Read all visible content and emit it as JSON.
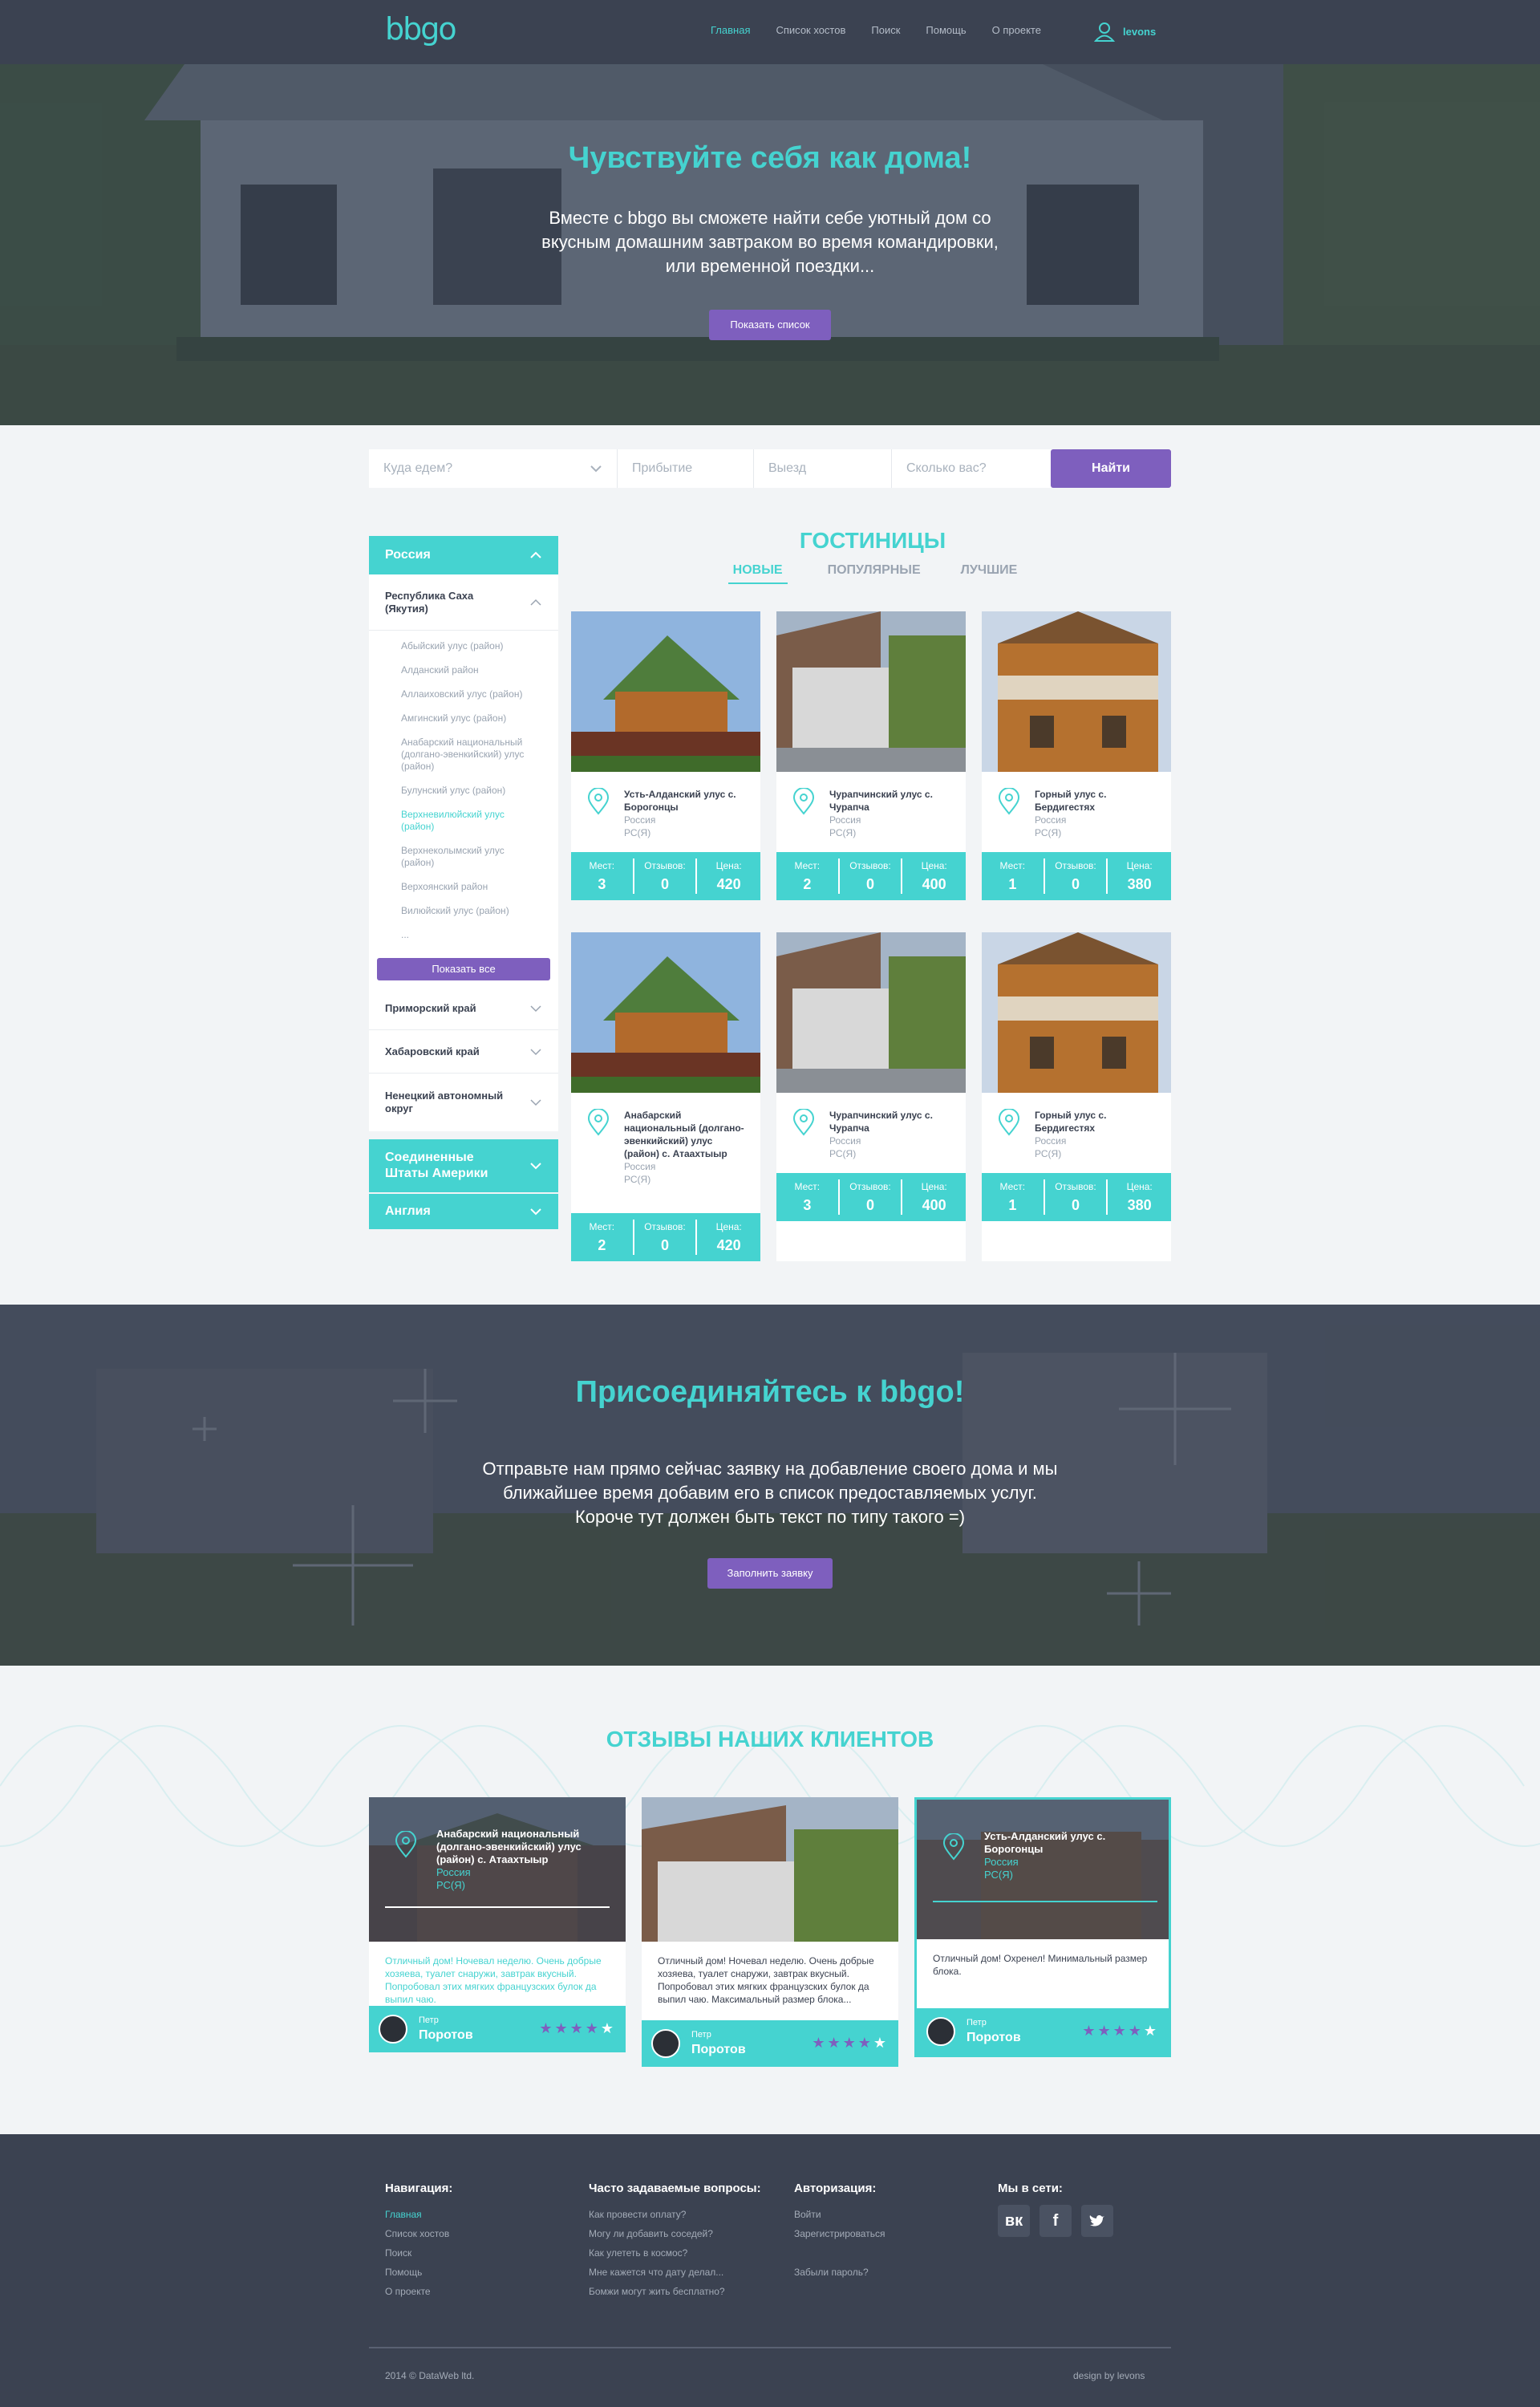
{
  "header": {
    "logo": "bbgo",
    "nav": [
      "Главная",
      "Список хостов",
      "Поиск",
      "Помощь",
      "О проекте"
    ],
    "user": "levons"
  },
  "hero": {
    "title": "Чувствуйте себя как дома!",
    "text": "Вместе с bbgo вы сможете найти себе уютный дом со вкусным домашним завтраком во время командировки, или временной поездки...",
    "button": "Показать список"
  },
  "search": {
    "where": "Куда едем?",
    "arrival": "Прибытие",
    "departure": "Выезд",
    "guests": "Сколько вас?",
    "button": "Найти"
  },
  "sidebar": {
    "country1": "Россия",
    "region_open": "Республика Саха (Якутия)",
    "districts": [
      "Абыйский улус (район)",
      "Алданский район",
      "Аллаиховский улус (район)",
      "Амгинский улус (район)",
      "Анабарский национальный (долгано-эвенкийский) улус (район)",
      "Булунский улус (район)",
      "Верхневилюйский улус (район)",
      "Верхнеколымский улус (район)",
      "Верхоянский район",
      "Вилюйский улус (район)",
      "..."
    ],
    "show_all": "Показать все",
    "regions": [
      "Приморский край",
      "Хабаровский край",
      "Ненецкий автономный округ"
    ],
    "country2": "Соединенные Штаты Америки",
    "country3": "Англия"
  },
  "catalog": {
    "title": "ГОСТИНИЦЫ",
    "tabs": [
      "НОВЫЕ",
      "ПОПУЛЯРНЫЕ",
      "ЛУЧШИЕ"
    ],
    "labels": {
      "places": "Мест:",
      "reviews": "Отзывов:",
      "price": "Цена:"
    },
    "cards": [
      {
        "name": "Усть-Алданский улус с. Борогонцы",
        "country": "Россия",
        "region": "РС(Я)",
        "places": "3",
        "reviews": "0",
        "price": "420"
      },
      {
        "name": "Чурапчинский улус с. Чурапча",
        "country": "Россия",
        "region": "РС(Я)",
        "places": "2",
        "reviews": "0",
        "price": "400"
      },
      {
        "name": "Горный улус с. Бердигестях",
        "country": "Россия",
        "region": "РС(Я)",
        "places": "1",
        "reviews": "0",
        "price": "380"
      },
      {
        "name": "Анабарский национальный (долгано-эвенкийский) улус (район) с. Атаахтыыр",
        "country": "Россия",
        "region": "РС(Я)",
        "places": "2",
        "reviews": "0",
        "price": "420"
      },
      {
        "name": "Чурапчинский улус с. Чурапча",
        "country": "Россия",
        "region": "РС(Я)",
        "places": "3",
        "reviews": "0",
        "price": "400"
      },
      {
        "name": "Горный улус с. Бердигестях",
        "country": "Россия",
        "region": "РС(Я)",
        "places": "1",
        "reviews": "0",
        "price": "380"
      }
    ]
  },
  "join": {
    "title": "Присоединяйтесь к bbgo!",
    "text": "Отправьте нам прямо сейчас заявку на добавление своего дома и мы ближайшее время добавим его в список предоставляемых услуг. Короче тут должен быть текст по типу такого =)",
    "button": "Заполнить заявку"
  },
  "reviews": {
    "title": "ОТЗЫВЫ НАШИХ КЛИЕНТОВ",
    "items": [
      {
        "place": "Анабарский национальный (долгано-эвенкийский) улус (район) с. Атаахтыыр",
        "country": "Россия",
        "region": "РС(Я)",
        "text": "Отличный дом! Ночевал неделю. Очень добрые хозяева, туалет снаружи, завтрак вкусный. Попробовал этих мягких французских булок да выпил чаю.",
        "first": "Петр",
        "last": "Поротов",
        "rating": 4
      },
      {
        "text": "Отличный дом! Ночевал неделю. Очень добрые хозяева, туалет снаружи, завтрак вкусный. Попробовал этих мягких французских булок да выпил чаю. Максимальный размер блока...",
        "first": "Петр",
        "last": "Поротов",
        "rating": 4
      },
      {
        "place": "Усть-Алданский улус с. Борогонцы",
        "country": "Россия",
        "region": "РС(Я)",
        "text": "Отличный дом! Охренел! Минимальный размер блока.",
        "first": "Петр",
        "last": "Поротов",
        "rating": 4
      }
    ]
  },
  "footer": {
    "nav_title": "Навигация:",
    "nav": [
      "Главная",
      "Список хостов",
      "Поиск",
      "Помощь",
      "О проекте"
    ],
    "faq_title": "Часто задаваемые вопросы:",
    "faq": [
      "Как провести оплату?",
      "Могу ли добавить соседей?",
      "Как улететь в космос?",
      "Мне кажется что дату делал...",
      "Бомжи могут жить бесплатно?"
    ],
    "auth_title": "Авторизация:",
    "auth": [
      "Войти",
      "Зарегистрироваться",
      "",
      "Забыли пароль?"
    ],
    "social_title": "Мы в сети:",
    "social": [
      "вк",
      "f",
      "t"
    ],
    "copyright": "2014 © DataWeb ltd.",
    "design": "design by levons"
  },
  "colors": {
    "accent": "#45d3d0",
    "purple": "#7e5fbe",
    "dark": "#3b4251"
  }
}
